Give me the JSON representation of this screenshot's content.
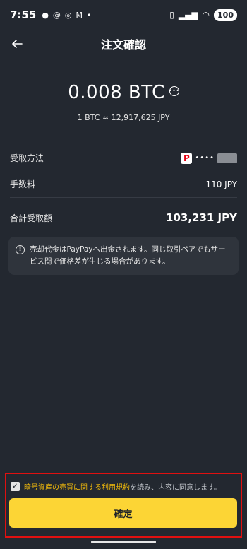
{
  "status_bar": {
    "time": "7:55",
    "battery": "100"
  },
  "header": {
    "title": "注文確認"
  },
  "order": {
    "amount": "0.008 BTC",
    "rate": "1 BTC ≈ 12,917,625 JPY"
  },
  "details": {
    "receive_method_label": "受取方法",
    "receive_method_masked": "••••",
    "fee_label": "手数料",
    "fee_value": "110 JPY",
    "total_label": "合計受取額",
    "total_value": "103,231 JPY"
  },
  "notice": {
    "text": "売却代金はPayPayへ出金されます。同じ取引ペアでもサービス間で価格差が生じる場合があります。"
  },
  "agreement": {
    "terms_link": "暗号資産の売買に関する利用規約",
    "suffix": "を読み、内容に同意します。",
    "checked": true
  },
  "confirm_button": {
    "label": "確定"
  },
  "colors": {
    "background": "#232830",
    "accent": "#fcd535",
    "link": "#f0b90b",
    "highlight_border": "#e01010",
    "paypay_red": "#e60012"
  }
}
